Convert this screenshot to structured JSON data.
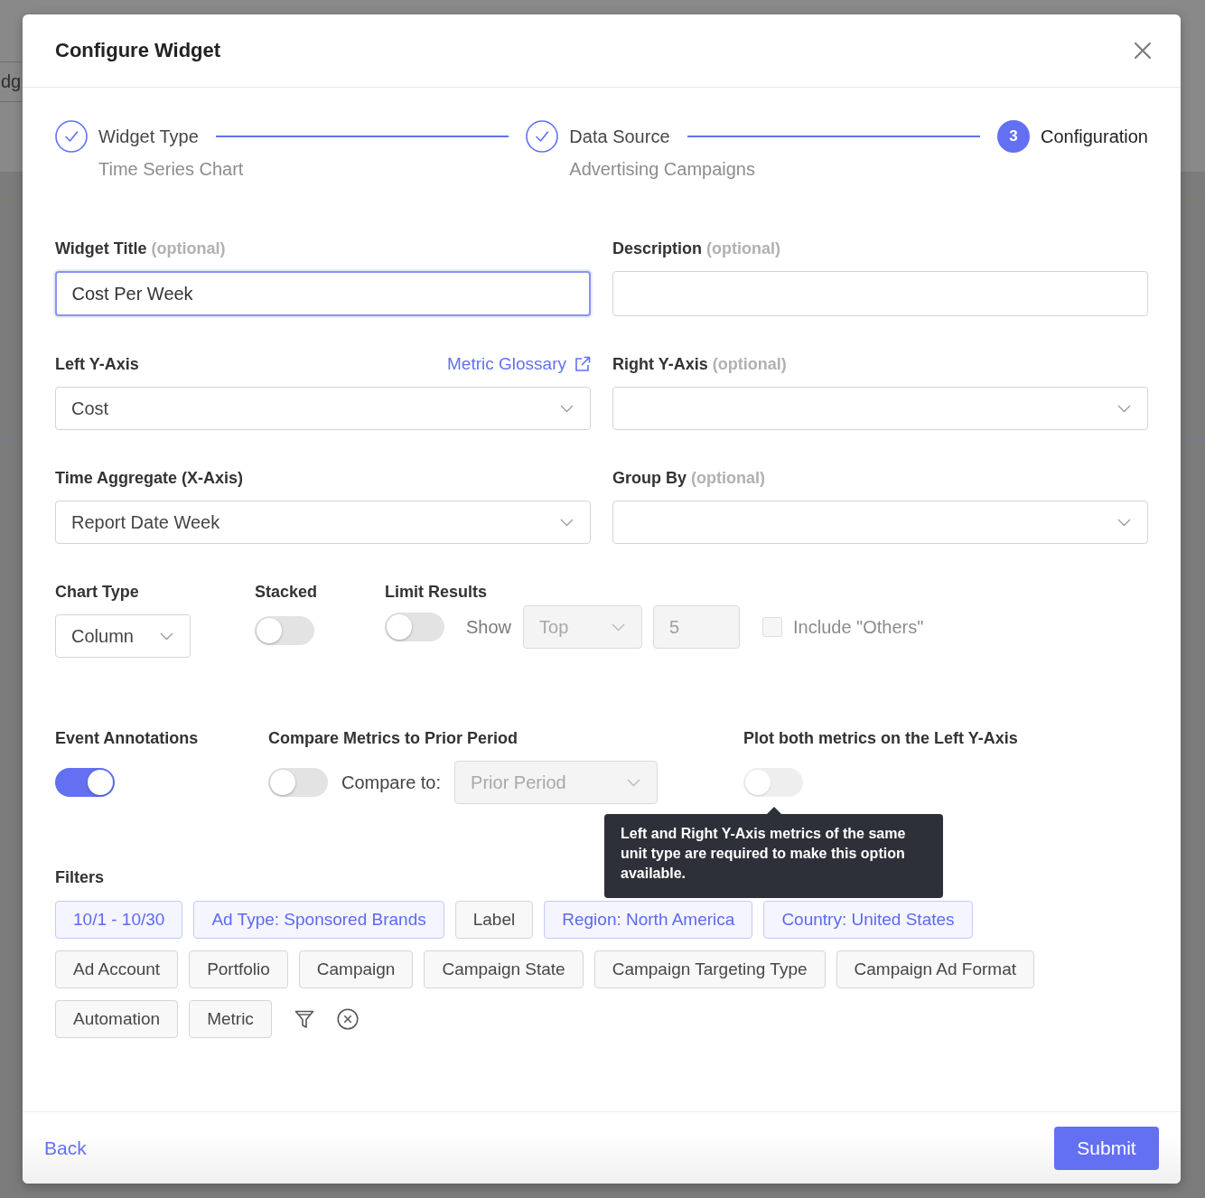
{
  "backdrop": {
    "text": "dg"
  },
  "dialog": {
    "title": "Configure Widget"
  },
  "stepper": {
    "steps": [
      {
        "label": "Widget Type",
        "detail": "Time Series Chart",
        "completed": true,
        "active": false
      },
      {
        "label": "Data Source",
        "detail": "Advertising Campaigns",
        "completed": true,
        "active": false
      },
      {
        "label": "Configuration",
        "number": "3",
        "completed": false,
        "active": true
      }
    ]
  },
  "fields": [
    {
      "kind": "text",
      "label": "Widget Title",
      "note": "(optional)",
      "value": "Cost Per Week",
      "focused": true
    },
    {
      "kind": "text",
      "label": "Description",
      "note": "(optional)",
      "focused": false
    },
    {
      "kind": "select",
      "label": "Left Y-Axis",
      "link": "Metric Glossary",
      "value": "Cost",
      "focused": false
    },
    {
      "kind": "select",
      "label": "Right Y-Axis",
      "note": "(optional)",
      "focused": false
    },
    {
      "kind": "select",
      "label": "Time Aggregate (X-Axis)",
      "value": "Report Date Week",
      "focused": false
    },
    {
      "kind": "select",
      "label": "Group By",
      "note": "(optional)",
      "focused": false
    }
  ],
  "chart_options": {
    "chart_type": {
      "label": "Chart Type",
      "value": "Column"
    },
    "stacked": {
      "label": "Stacked",
      "on": false
    },
    "limit_results": {
      "label": "Limit Results",
      "on": false,
      "show_label": "Show",
      "order": "Top",
      "count": "5",
      "disabled": true,
      "include_others": {
        "label": "Include \"Others\"",
        "checked": false
      }
    }
  },
  "compare_options": {
    "event_annotations": {
      "label": "Event Annotations",
      "on": true
    },
    "compare": {
      "label": "Compare Metrics to Prior Period",
      "on": false,
      "compare_label": "Compare to:",
      "period": "Prior Period",
      "disabled": true
    },
    "plot_left": {
      "label": "Plot both metrics on the Left Y-Axis",
      "on": false,
      "disabled": true,
      "tooltip": "Left and Right Y-Axis metrics of the same unit type are required to make this option available."
    }
  },
  "filters": {
    "label": "Filters",
    "chips": [
      {
        "label": "10/1 - 10/30",
        "selected": true
      },
      {
        "label": "Ad Type: Sponsored Brands",
        "selected": true
      },
      {
        "label": "Label",
        "selected": false
      },
      {
        "label": "Region: North America",
        "selected": true
      },
      {
        "label": "Country: United States",
        "selected": true
      },
      {
        "label": "Ad Account",
        "selected": false
      },
      {
        "label": "Portfolio",
        "selected": false
      },
      {
        "label": "Campaign",
        "selected": false
      },
      {
        "label": "Campaign State",
        "selected": false
      },
      {
        "label": "Campaign Targeting Type",
        "selected": false
      },
      {
        "label": "Campaign Ad Format",
        "selected": false
      },
      {
        "label": "Automation",
        "selected": false
      },
      {
        "label": "Metric",
        "selected": false
      }
    ]
  },
  "footer": {
    "back": "Back",
    "submit": "Submit"
  }
}
